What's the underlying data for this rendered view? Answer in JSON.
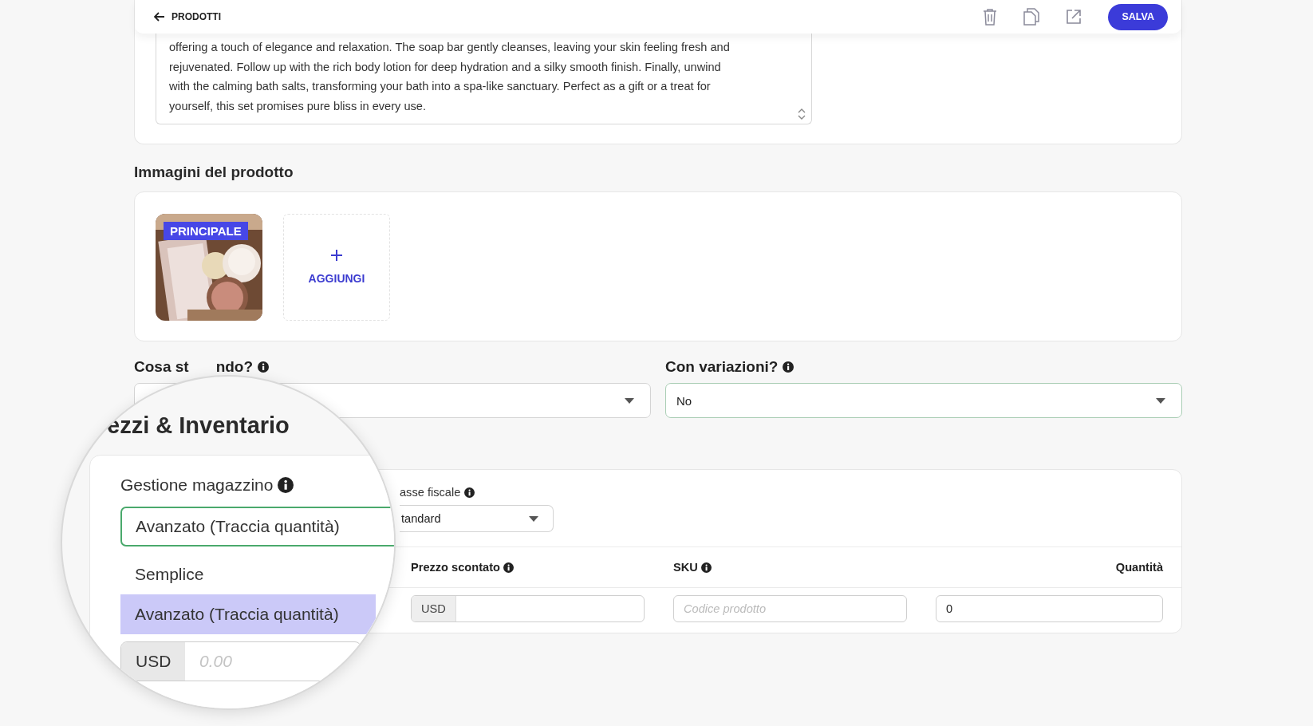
{
  "header": {
    "back_label": "PRODOTTI",
    "save_button": "SALVA"
  },
  "description": {
    "lines": [
      "offering a touch of elegance and relaxation. The soap bar gently cleanses, leaving your skin feeling fresh and",
      "rejuvenated. Follow up with the rich body lotion for deep hydration and a silky smooth finish. Finally, unwind",
      "with the calming bath salts, transforming your bath into a spa-like sanctuary. Perfect as a gift or a treat for",
      "yourself, this set promises pure bliss in every use."
    ]
  },
  "images": {
    "title": "Immagini del prodotto",
    "items": [
      {
        "kind": "picture",
        "badge": "PRINCIPALE"
      }
    ],
    "add_label": "AGGIUNGI"
  },
  "product_type": {
    "label_start": "Cosa st",
    "label_end": "ndo?"
  },
  "variations": {
    "label": "Con variazioni?",
    "value": "No"
  },
  "pricing": {
    "tax_label": "asse fiscale",
    "tax_value": "tandard",
    "columns": [
      {
        "label": "Prezzo scontato",
        "info": true
      },
      {
        "label": "SKU",
        "info": true
      },
      {
        "label": "Quantità",
        "info": false
      }
    ],
    "discount_currency": "USD",
    "sku_placeholder": "Codice prodotto",
    "quantity": "0"
  },
  "magnifier": {
    "heading": "ezzi & Inventario",
    "stock_label": "Gestione magazzino",
    "stock_value": "Avanzato (Traccia quantità)",
    "options": [
      {
        "label": "Semplice",
        "selected": false
      },
      {
        "label": "Avanzato (Traccia quantità)",
        "selected": true
      }
    ],
    "price_currency": "USD",
    "price_placeholder": "0.00"
  }
}
